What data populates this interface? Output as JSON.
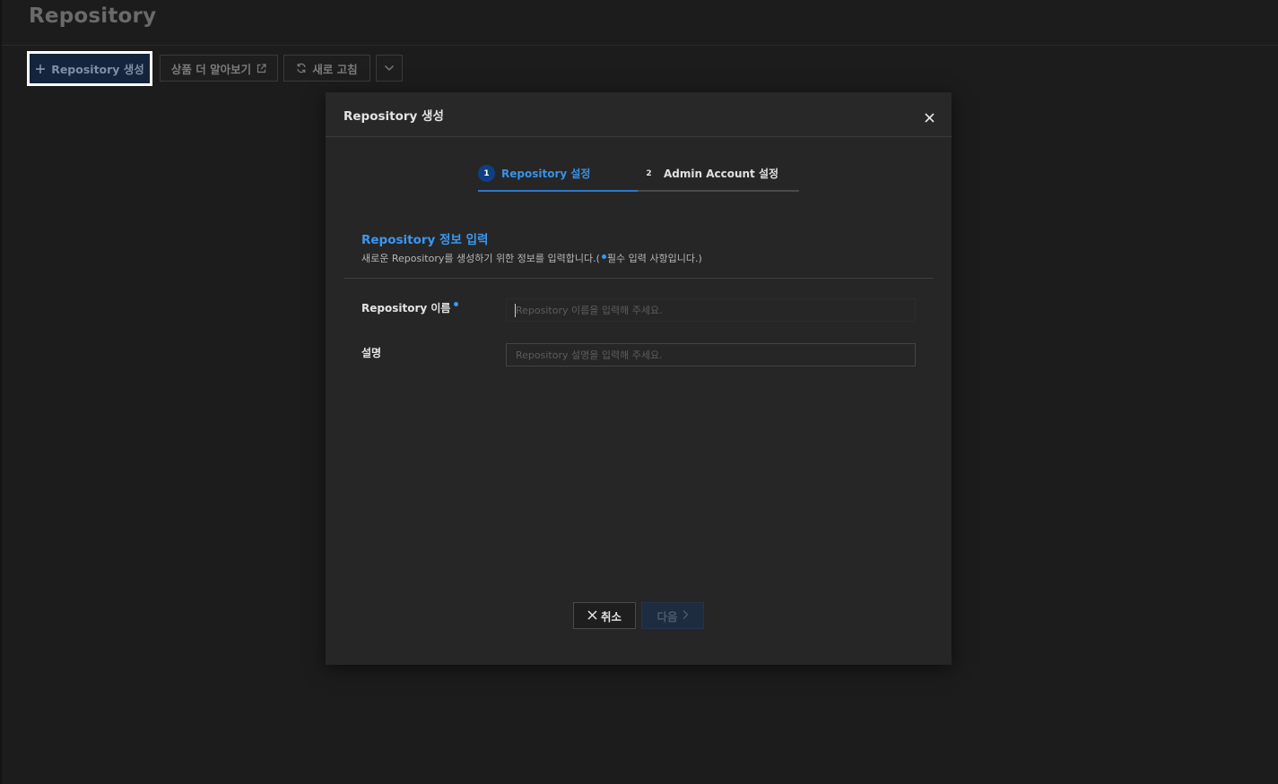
{
  "page": {
    "title": "Repository"
  },
  "toolbar": {
    "create_label": "Repository 생성",
    "learn_more_label": "상품 더 알아보기",
    "refresh_label": "새로 고침",
    "more_icon": "chevron-down-icon"
  },
  "modal": {
    "title": "Repository 생성",
    "steps": [
      {
        "number": "1",
        "label": "Repository 설정",
        "active": true
      },
      {
        "number": "2",
        "label": "Admin Account 설정",
        "active": false
      }
    ],
    "section": {
      "title": "Repository 정보 입력",
      "desc_before": "새로운 Repository를 생성하기 위한 정보를 입력합니다.(",
      "desc_after": "필수 입력 사항입니다.)"
    },
    "fields": {
      "name": {
        "label": "Repository 이름",
        "value": "",
        "placeholder": "Repository 이름을 입력해 주세요.",
        "required": true
      },
      "description": {
        "label": "설명",
        "value": "",
        "placeholder": "Repository 설명을 입력해 주세요.",
        "required": false
      }
    },
    "footer": {
      "cancel_label": "취소",
      "next_label": "다음",
      "next_enabled": false
    }
  },
  "colors": {
    "accent": "#3b98f0",
    "background": "#1c1c1c",
    "modal_background": "#262626",
    "primary_button": "#14243c"
  }
}
